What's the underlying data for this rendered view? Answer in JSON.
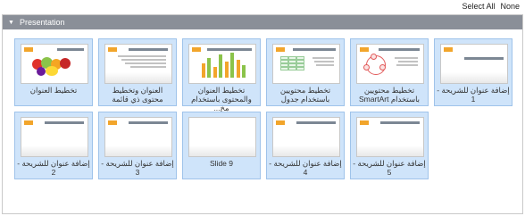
{
  "top_links": {
    "select_all": "Select All",
    "none": "None"
  },
  "section": {
    "title": "Presentation"
  },
  "slides": [
    {
      "label": "تخطيط العنوان",
      "kind": "title"
    },
    {
      "label": "العنوان وتخطيط محتوى ذي قائمة",
      "kind": "list"
    },
    {
      "label": "تخطيط العنوان والمحتوى باستخدام مخ...",
      "kind": "chart"
    },
    {
      "label": "تخطيط محتويين باستخدام جدول",
      "kind": "table"
    },
    {
      "label": "تخطيط محتويين باستخدام SmartArt",
      "kind": "smartart"
    },
    {
      "label": "إضافة عنوان للشريحة - 1",
      "kind": "header"
    },
    {
      "label": "إضافة عنوان للشريحة - 2",
      "kind": "header"
    },
    {
      "label": "إضافة عنوان للشريحة - 3",
      "kind": "header"
    },
    {
      "label": "Slide 9",
      "kind": "blank"
    },
    {
      "label": "إضافة عنوان للشريحة - 4",
      "kind": "header"
    },
    {
      "label": "إضافة عنوان للشريحة - 5",
      "kind": "header"
    }
  ],
  "colors": {
    "tile_bg": "#cfe4fa",
    "header_bg": "#8a8f98",
    "accent": "#f2a52b"
  }
}
